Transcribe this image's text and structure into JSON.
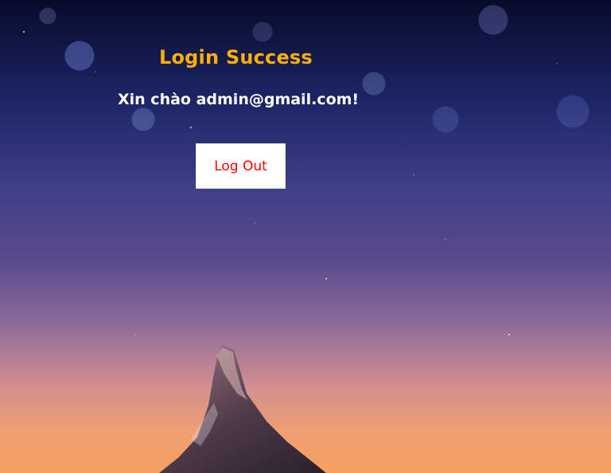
{
  "page": {
    "title": "Login Success",
    "greeting": "Xin chào admin@gmail.com!",
    "logout_label": "Log Out"
  },
  "icons": {
    "background": "starry-sky-mountain-background"
  },
  "colors": {
    "title": "#ffb000",
    "greeting": "#ffffff",
    "button_bg": "#ffffff",
    "button_text": "#ff0000"
  }
}
